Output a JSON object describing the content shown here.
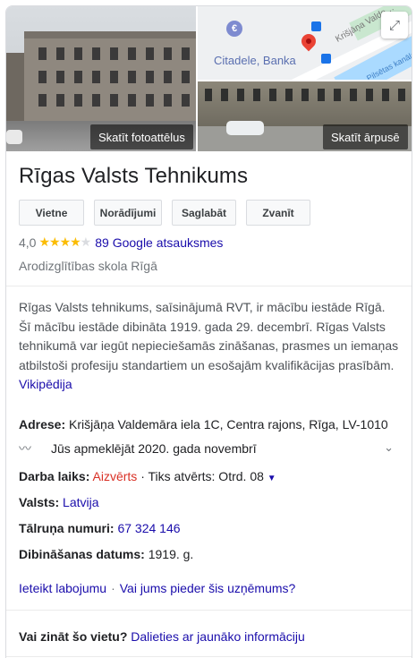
{
  "hero": {
    "btn_photos": "Skatīt fotoattēlus",
    "btn_outside": "Skatīt ārpusē",
    "map_label": "Citadele, Banka",
    "street_label": "Krišjāņa Valde…",
    "river_label": "Pilsētas kanāls"
  },
  "place": {
    "title": "Rīgas Valsts Tehnikums",
    "rating": "4,0",
    "reviews": "89 Google atsauksmes",
    "category": "Arodizglītības skola Rīgā"
  },
  "actions": {
    "website": "Vietne",
    "directions": "Norādījumi",
    "save": "Saglabāt",
    "call": "Zvanīt"
  },
  "description": {
    "text": "Rīgas Valsts tehnikums, saīsinājumā RVT, ir mācību iestāde Rīgā. Šī mācību iestāde dibināta 1919. gada 29. decembrī. Rīgas Valsts tehnikumā var iegūt nepieciešamās zināšanas, prasmes un iemaņas atbilstoši profesiju standartiem un esošajām kvalifikācijas prasībām.",
    "source": "Vikipēdija"
  },
  "details": {
    "address_label": "Adrese:",
    "address": "Krišjāņa Valdemāra iela 1C, Centra rajons, Rīga, LV-1010",
    "visited": "Jūs apmeklējāt 2020. gada novembrī",
    "hours_label": "Darba laiks:",
    "hours_status": "Aizvērts",
    "hours_next": "· Tiks atvērts: Otrd. 08",
    "country_label": "Valsts:",
    "country": "Latvija",
    "phone_label": "Tālruņa numuri:",
    "phone": "67 324 146",
    "founded_label": "Dibināšanas datums:",
    "founded": "1919. g."
  },
  "footer": {
    "suggest_edit": "Ieteikt labojumu",
    "own_business": "Vai jums pieder šis uzņēmums?",
    "know_label": "Vai zināt šo vietu?",
    "share_info": "Dalieties ar jaunāko informāciju"
  },
  "colors": {
    "link": "#1a0dab",
    "closed": "#d93025",
    "star": "#fbbc04"
  }
}
